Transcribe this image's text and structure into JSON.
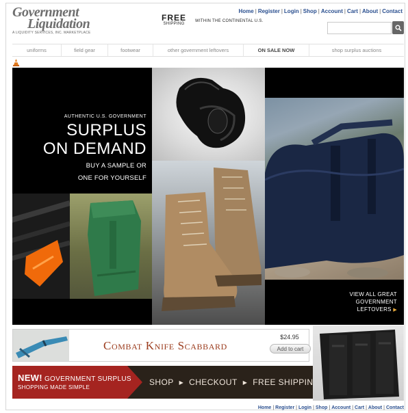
{
  "header": {
    "logo_line1": "Government",
    "logo_line2": "Liquidation",
    "logo_tagline": "A LIQUIDITY SERVICES, INC. MARKETPLACE",
    "free_big": "FREE",
    "free_small": "SHIPPING",
    "free_note": "WITHIN THE CONTINENTAL U.S.",
    "search_placeholder": ""
  },
  "toplinks": [
    "Home",
    "Register",
    "Login",
    "Shop",
    "Account",
    "Cart",
    "About",
    "Contact"
  ],
  "nav": [
    "uniforms",
    "field gear",
    "footwear",
    "other government leftovers",
    "ON SALE NOW",
    "shop surplus auctions"
  ],
  "hero": {
    "authentic": "AUTHENTIC U.S. GOVERNMENT",
    "big_line1": "SURPLUS",
    "big_line2": "ON DEMAND",
    "sub_line1": "BUY A SAMPLE OR",
    "sub_line2": "ONE FOR YOURSELF",
    "view_line1": "VIEW ALL GREAT",
    "view_line2": "GOVERNMENT",
    "view_line3": "LEFTOVERS"
  },
  "promo": {
    "title": "Combat Knife Scabbard",
    "price": "$24.95",
    "add_to_cart": "Add to cart"
  },
  "banner": {
    "new": "NEW!",
    "line1": "GOVERNMENT SURPLUS",
    "line2": "SHOPPING MADE SIMPLE",
    "step1": "SHOP",
    "step2": "CHECKOUT",
    "step3": "FREE SHIPPING"
  },
  "colors": {
    "link_blue": "#2a4f8f",
    "banner_red": "#a52420",
    "banner_dark": "#2a221a",
    "scabbard_title": "#9a3a1b"
  }
}
